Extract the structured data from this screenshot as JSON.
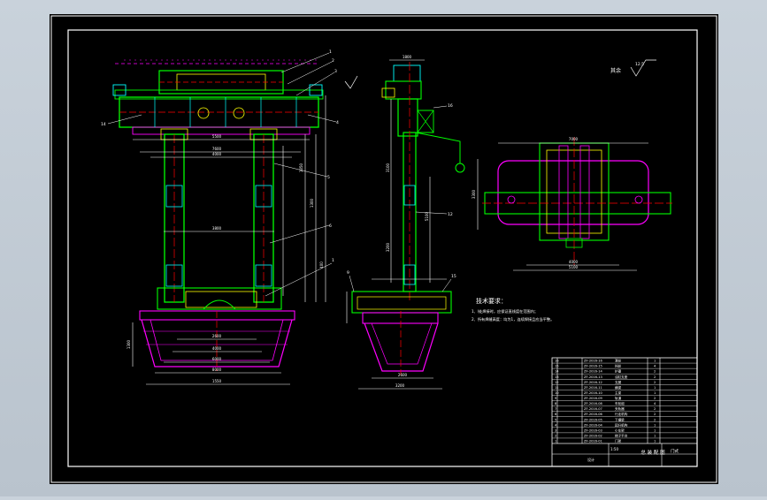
{
  "colors": {
    "paper": "#000000",
    "frame": "#ffffff",
    "structure": "#00ff00",
    "section": "#ff00ff",
    "centerline": "#ff0000",
    "dimension": "#ffffff",
    "accent": "#ffff00",
    "detail": "#00ffff"
  },
  "drawing": {
    "roughness_prefix": "其余",
    "roughness_value": "12.5",
    "tech_title": "技术要求：",
    "tech_notes": [
      "1、Ⅰ处焊接时，应保证直线度在范围内；",
      "2、所有焊缝高度：均为1，连续焊接且应当平整。"
    ],
    "scale_ratio": "1:50"
  },
  "front_view": {
    "dims": [
      "5500",
      "7600",
      "4000",
      "3800",
      "1050",
      "1550",
      "400",
      "2600",
      "4000",
      "6000",
      "8000",
      "1300"
    ],
    "balloons": [
      "1",
      "2",
      "3",
      "4",
      "5",
      "6",
      "7",
      "8",
      "9",
      "10",
      "14"
    ]
  },
  "side_view": {
    "dims": [
      "1800",
      "3100",
      "5100",
      "3200",
      "2600",
      "3200"
    ],
    "balloons": [
      "10",
      "11",
      "12",
      "15",
      "9",
      "8"
    ]
  },
  "plan_view": {
    "dims": [
      "7000",
      "3300",
      "4000",
      "5100"
    ]
  },
  "title_block": {
    "rows": [
      {
        "no": "16",
        "code": "ZF-2016-16",
        "name": "滑轮",
        "qty": "1"
      },
      {
        "no": "15",
        "code": "ZF-2016-15",
        "name": "挡轮",
        "qty": "4"
      },
      {
        "no": "14",
        "code": "ZF-2016-14",
        "name": "护罩",
        "qty": "2"
      },
      {
        "no": "13",
        "code": "ZF-2016-13",
        "name": "油缸支座",
        "qty": "2"
      },
      {
        "no": "12",
        "code": "ZF-2016-12",
        "name": "支腿",
        "qty": "2"
      },
      {
        "no": "11",
        "code": "ZF-2016-11",
        "name": "横梁",
        "qty": "1"
      },
      {
        "no": "10",
        "code": "ZF-2016-10",
        "name": "主梁",
        "qty": "1"
      },
      {
        "no": "9",
        "code": "ZF-2016-09",
        "name": "轨道",
        "qty": "2"
      },
      {
        "no": "8",
        "code": "ZF-2016-08",
        "name": "车轮组",
        "qty": "4"
      },
      {
        "no": "7",
        "code": "ZF-2016-07",
        "name": "夹轨器",
        "qty": "2"
      },
      {
        "no": "6",
        "code": "ZF-2016-06",
        "name": "行走机构",
        "qty": "2"
      },
      {
        "no": "5",
        "code": "ZF-2016-05",
        "name": "下横梁",
        "qty": "2"
      },
      {
        "no": "4",
        "code": "ZF-2016-04",
        "name": "起升机构",
        "qty": "1"
      },
      {
        "no": "3",
        "code": "ZF-2016-03",
        "name": "小车架",
        "qty": "1"
      },
      {
        "no": "2",
        "code": "ZF-2016-02",
        "name": "梯子平台",
        "qty": "1"
      },
      {
        "no": "1",
        "code": "ZF-2016-01",
        "name": "门架",
        "qty": "1"
      }
    ],
    "stamp": "门式",
    "drawing_title": "总 装 配 图",
    "designer_label": "设计"
  }
}
